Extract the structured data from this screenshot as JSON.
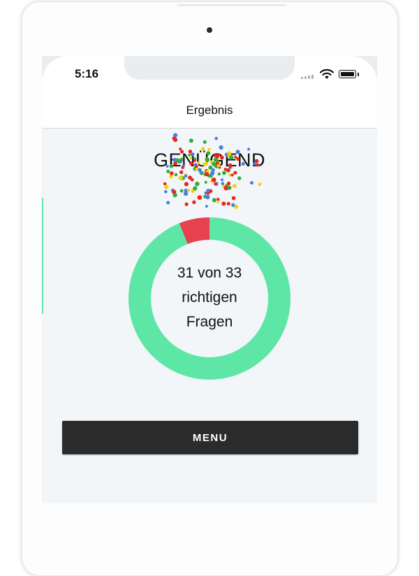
{
  "status_bar": {
    "time": "5:16",
    "icons": [
      "cellular-signal-icon",
      "wifi-icon",
      "battery-icon"
    ]
  },
  "nav": {
    "title": "Ergebnis"
  },
  "result": {
    "grade": "GENÜGEND",
    "correct": 31,
    "total": 33,
    "summary_line1": "31 von 33",
    "summary_line2": "richtigen",
    "summary_line3": "Fragen"
  },
  "button": {
    "menu_label": "MENU"
  },
  "colors": {
    "correct": "#5ee6a6",
    "wrong": "#e8404f",
    "background": "#f2f6f8",
    "button": "#2b2b2b",
    "confetti": [
      "#e8271e",
      "#f5d10c",
      "#2fae3c",
      "#4a7fe2"
    ]
  }
}
